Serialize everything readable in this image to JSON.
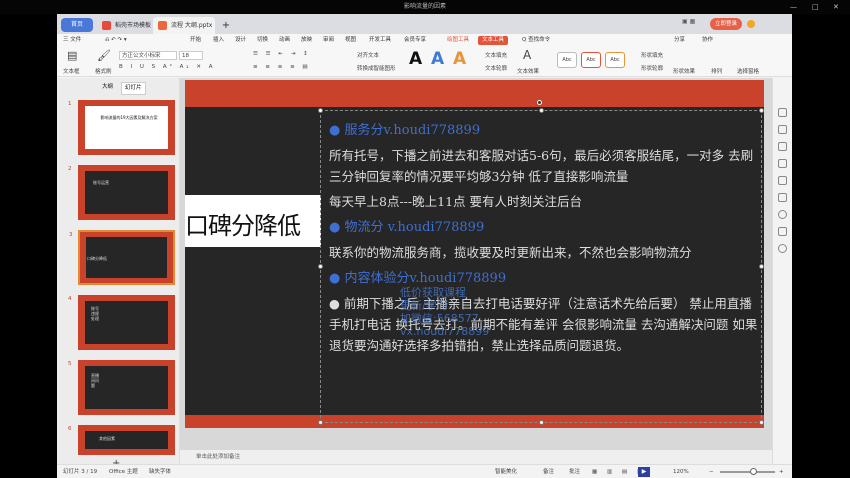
{
  "window": {
    "title": "影响流量的因素"
  },
  "tabs": {
    "home": "首页",
    "store": "稻壳市场模板",
    "doc": "流程 大纲.pptx",
    "add": "+"
  },
  "top_right": {
    "signin": "立即登录",
    "share": "分享",
    "collab": "协作"
  },
  "menu": [
    "三 文件",
    "开始",
    "插入",
    "设计",
    "切换",
    "动画",
    "放映",
    "审阅",
    "视图",
    "开发工具",
    "会员专享"
  ],
  "menu_tool1": "绘图工具",
  "menu_tool2": "文本工具",
  "menu_search": "Q 查找命令",
  "ribbon": {
    "textbox": "文本框",
    "format_painter": "格式刷",
    "font": "方正公文小标宋",
    "size": "18",
    "text_fill": "文本填充",
    "text_outline": "文本轮廓",
    "text_effect": "文本效果",
    "align_text": "对齐文本",
    "convert": "转换成智能图形",
    "style_label": "Abc",
    "shape_fill": "形状填充",
    "shape_outline": "形状轮廓",
    "shape_effect": "形状效果",
    "arrange": "排列",
    "select": "选择窗格"
  },
  "left_panel": {
    "tab_outline": "大纲",
    "tab_slides": "幻灯片"
  },
  "thumbs": [
    {
      "num": "1",
      "text": "影响流量的19大因素及解决方案"
    },
    {
      "num": "2",
      "text": "账号运营"
    },
    {
      "num": "3",
      "text": "口碑分降低"
    },
    {
      "num": "4",
      "text": "账号违规处理"
    },
    {
      "num": "5",
      "text": "直播间问题"
    },
    {
      "num": "6",
      "text": "其他因素"
    }
  ],
  "slide": {
    "big_title": "口碑分降低",
    "h1": "● 服务分v.houdi778899",
    "p1": "所有托号，下播之前进去和客服对话5-6句，最后必须客服结尾，一对多 去刷三分钟回复率的情况要平均够3分钟 低了直接影响流量",
    "p2": "每天早上8点---晚上11点 要有人时刻关注后台",
    "h2": "● 物流分 v.houdi778899",
    "p3": "联系你的物流服务商，揽收要及时更新出来，不然也会影响物流分",
    "h3": "● 内容体验分v.houdi778899",
    "p4": "● 前期下播之后 主播亲自去打电话要好评（注意话术先给后要） 禁止用直播手机打电话 换托号去打。前期不能有差评 会很影响流量 去沟通解决问题 如果退货要沟通好选择多拍错拍，禁止选择品质问题退货。",
    "watermark": [
      "低价获取课程",
      "更新/学习",
      "加微信:568577",
      "vx.houdi778899"
    ]
  },
  "note": "单击此处添加备注",
  "status": {
    "slide_count": "幻灯片 3 / 19",
    "theme": "Office 主题",
    "font_missing": "缺失字体",
    "smart": "智能美化",
    "notes": "备注",
    "comments": "批注",
    "zoom": "120%"
  },
  "zoom_level": 0.6,
  "colors": {
    "slide_red": "#c9432c",
    "slide_dark": "#262626",
    "heading_blue": "#3f6fd0",
    "accent": "#e2553a"
  }
}
